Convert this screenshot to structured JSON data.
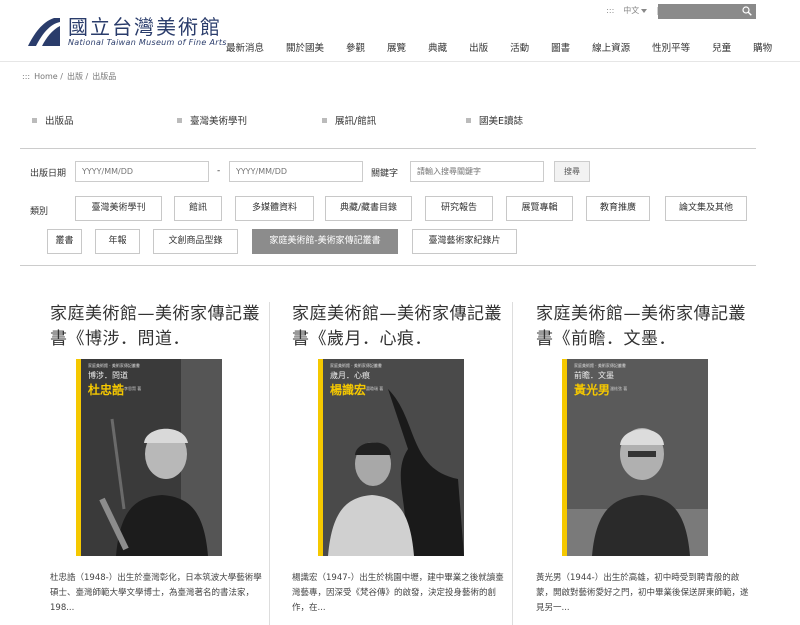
{
  "logo": {
    "zh": "國立台灣美術館",
    "en": "National Taiwan Museum of Fine Arts"
  },
  "util": {
    "sitemap": ":::",
    "lang": "中文",
    "search_placeholder": ""
  },
  "nav": [
    "最新消息",
    "關於國美",
    "參觀",
    "展覽",
    "典藏",
    "出版",
    "活動",
    "圖書",
    "線上資源",
    "性別平等",
    "兒童",
    "購物"
  ],
  "breadcrumb": [
    ":::",
    "Home /",
    "出版 /",
    "出版品"
  ],
  "subtabs": [
    {
      "label": "出版品",
      "active": true
    },
    {
      "label": "臺灣美術學刊",
      "active": false
    },
    {
      "label": "展訊/館訊",
      "active": false
    },
    {
      "label": "國美E讀誌",
      "active": false
    }
  ],
  "filter": {
    "date_label": "出版日期",
    "date_from_placeholder": "YYYY/MM/DD",
    "dash": "-",
    "date_to_placeholder": "YYYY/MM/DD",
    "keyword_label": "關鍵字",
    "keyword_placeholder": "請輸入搜尋關鍵字",
    "search_button": "搜尋",
    "category_label": "類別"
  },
  "categories": [
    {
      "label": "臺灣美術學刊",
      "active": false
    },
    {
      "label": "館訊",
      "active": false
    },
    {
      "label": "多媒體資料",
      "active": false
    },
    {
      "label": "典藏/藏書目錄",
      "active": false
    },
    {
      "label": "研究報告",
      "active": false
    },
    {
      "label": "展覽專輯",
      "active": false
    },
    {
      "label": "教育推廣",
      "active": false
    },
    {
      "label": "論文集及其他",
      "active": false
    },
    {
      "label": "叢書",
      "active": false
    },
    {
      "label": "年報",
      "active": false
    },
    {
      "label": "文創商品型錄",
      "active": false
    },
    {
      "label": "家庭美術館-美術家傳記叢書",
      "active": true
    },
    {
      "label": "臺灣藝術家紀錄片",
      "active": false
    }
  ],
  "cards": [
    {
      "title": "家庭美術館—美術家傳記叢書《博涉．問道．",
      "cover": {
        "series": "家庭美術館 · 美術家傳記叢書",
        "subtitle": "博涉．問道",
        "artist": "杜忠誥",
        "author": "李思賢 著"
      },
      "desc": "杜忠誥（1948-）出生於臺灣彰化，日本筑波大學藝術學碩士、臺灣師範大學文學博士，為臺灣著名的書法家，198..."
    },
    {
      "title": "家庭美術館—美術家傳記叢書《歲月．心痕．",
      "cover": {
        "series": "家庭美術館 · 美術家傳記叢書",
        "subtitle": "歲月．心痕",
        "artist": "楊識宏",
        "author": "蕭瓊瑞 著"
      },
      "desc": "楊識宏（1947-）出生於桃園中壢，建中畢業之後就讀臺灣藝專，因深受《梵谷傳》的啟發，決定投身藝術的創作，在..."
    },
    {
      "title": "家庭美術館—美術家傳記叢書《前瞻．文墨．",
      "cover": {
        "series": "家庭美術館 · 美術家傳記叢書",
        "subtitle": "前瞻．文墨",
        "artist": "黃光男",
        "author": "潘絃弦 著"
      },
      "desc": "黃光男（1944-）出生於高雄，初中時受到聘青般的啟蒙，開啟對藝術愛好之門，初中畢業後保送屏東師範，遂見另一..."
    }
  ]
}
